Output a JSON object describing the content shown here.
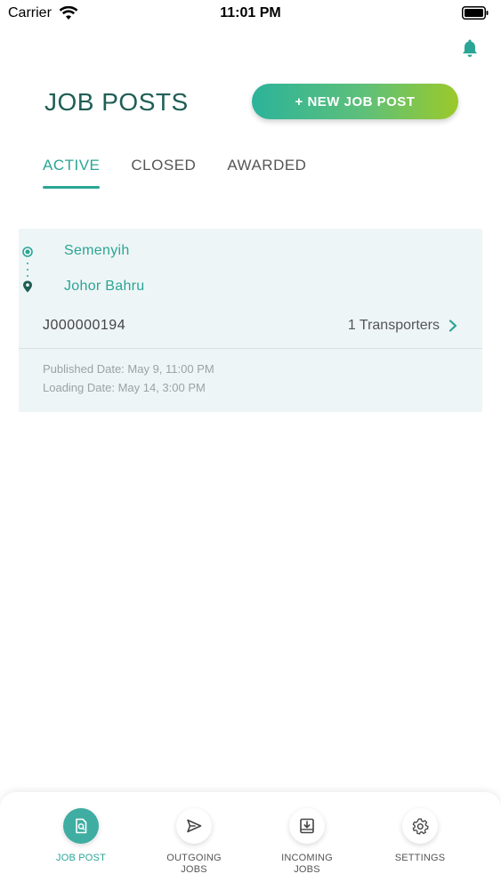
{
  "status_bar": {
    "carrier": "Carrier",
    "time": "11:01 PM"
  },
  "header": {
    "title": "JOB POSTS",
    "new_post_label": "+ NEW JOB POST"
  },
  "tabs": [
    {
      "label": "ACTIVE",
      "active": true
    },
    {
      "label": "CLOSED",
      "active": false
    },
    {
      "label": "AWARDED",
      "active": false
    }
  ],
  "job_card": {
    "origin": "Semenyih",
    "destination": "Johor Bahru",
    "job_id": "J000000194",
    "transporters": "1 Transporters",
    "published": "Published Date: May 9, 11:00 PM",
    "loading": "Loading Date: May 14, 3:00 PM"
  },
  "bottom_nav": [
    {
      "label": "JOB POST",
      "icon": "job-post-icon",
      "active": true
    },
    {
      "label": "OUTGOING\nJOBS",
      "icon": "send-icon",
      "active": false
    },
    {
      "label": "INCOMING\nJOBS",
      "icon": "inbox-download-icon",
      "active": false
    },
    {
      "label": "SETTINGS",
      "icon": "gear-icon",
      "active": false
    }
  ],
  "colors": {
    "accent": "#2aa596",
    "title": "#1f5e55",
    "gradient_start": "#2cb39a",
    "gradient_end": "#9bc92a"
  }
}
